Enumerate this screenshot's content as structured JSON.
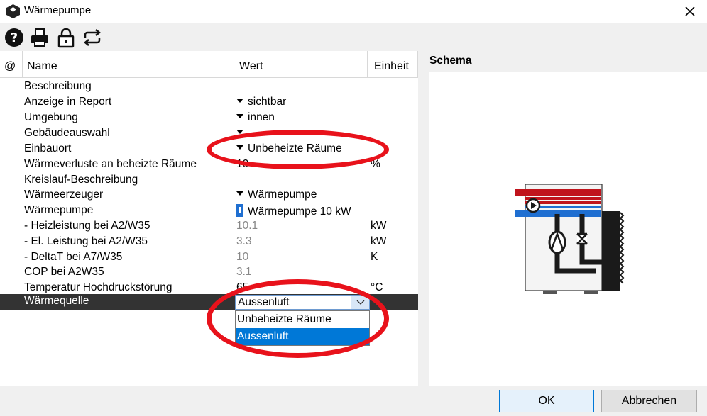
{
  "window": {
    "title": "Wärmepumpe",
    "app_icon": "hexagon-logo-icon",
    "close_icon": "close-icon"
  },
  "toolbar": {
    "icons": [
      "help-icon",
      "print-icon",
      "lock-icon",
      "swap-icon"
    ]
  },
  "table": {
    "headers": {
      "at": "@",
      "name": "Name",
      "value": "Wert",
      "unit": "Einheit"
    },
    "rows": [
      {
        "name": "Beschreibung",
        "value": "",
        "unit": ""
      },
      {
        "name": "Anzeige in Report",
        "value": "sichtbar",
        "unit": ""
      },
      {
        "name": "Umgebung",
        "value": "innen",
        "unit": ""
      },
      {
        "name": "Gebäudeauswahl",
        "value": "",
        "unit": ""
      },
      {
        "name": "Einbauort",
        "value": "Unbeheizte Räume",
        "unit": ""
      },
      {
        "name": "Wärmeverluste an beheizte Räume",
        "value": "10",
        "unit": "%"
      },
      {
        "name": "Kreislauf-Beschreibung",
        "value": "",
        "unit": ""
      },
      {
        "name": "Wärmeerzeuger",
        "value": "Wärmepumpe",
        "unit": ""
      },
      {
        "name": "Wärmepumpe",
        "value": "Wärmepumpe 10 kW",
        "unit": ""
      },
      {
        "name": "- Heizleistung bei A2/W35",
        "value": "10.1",
        "unit": "kW"
      },
      {
        "name": "- El. Leistung bei A2/W35",
        "value": "3.3",
        "unit": "kW"
      },
      {
        "name": "- DeltaT bei A7/W35",
        "value": "10",
        "unit": "K"
      },
      {
        "name": "COP bei A2W35",
        "value": "3.1",
        "unit": ""
      },
      {
        "name": "Temperatur Hochdruckstörung",
        "value": "65",
        "unit": "°C"
      },
      {
        "name": "Wärmequelle",
        "value": "",
        "unit": ""
      }
    ]
  },
  "waermequelle_select": {
    "selected": "Aussenluft",
    "options": [
      "Unbeheizte Räume",
      "Aussenluft"
    ],
    "highlighted": "Aussenluft"
  },
  "schema": {
    "title": "Schema"
  },
  "footer": {
    "ok_label": "OK",
    "cancel_label": "Abbrechen"
  },
  "colors": {
    "selected_row": "#333333",
    "highlight": "#0078d7",
    "annotation": "#e8121b",
    "hot_pipe": "#c0141c",
    "cold_pipe": "#1f6fd1"
  }
}
